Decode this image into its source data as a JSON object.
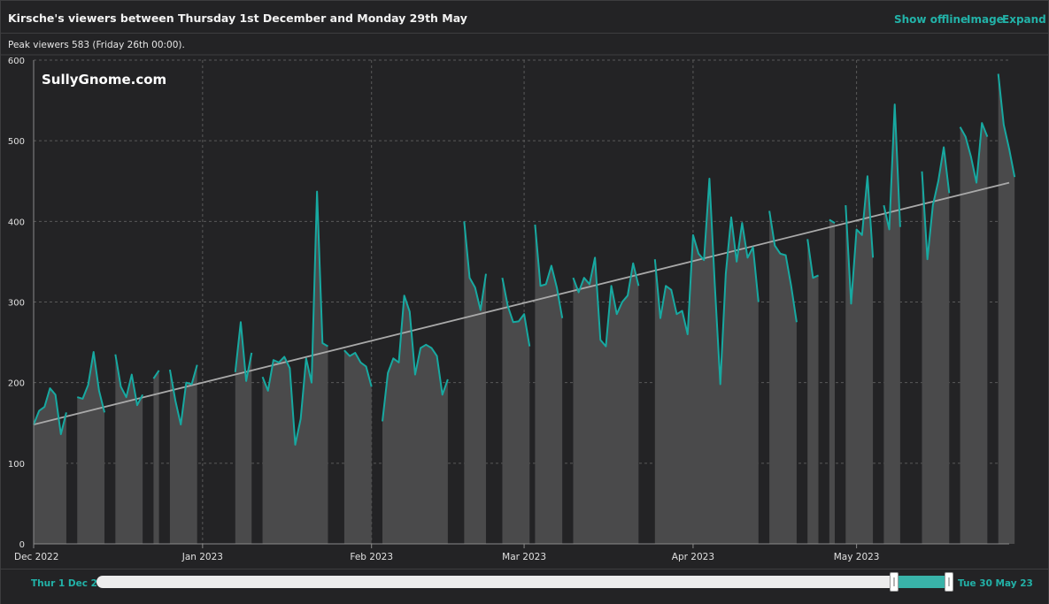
{
  "header": {
    "title": "Kirsche's viewers between Thursday 1st December and Monday 29th May",
    "links": {
      "show_offline": "Show offline",
      "image": "Image",
      "expand": "Expand"
    }
  },
  "peak_text": "Peak viewers 583 (Friday 26th 00:00).",
  "watermark": "SullyGnome.com",
  "range": {
    "start_label": "Thur 1 Dec 22",
    "end_label": "Tue 30 May 23",
    "selected_start_fraction": 0.93,
    "selected_end_fraction": 0.99
  },
  "colors": {
    "line": "#17a9a1",
    "area": "#4a4a4b",
    "trend": "#a9a9a9",
    "grid": "#5a5a5a",
    "accent": "#22b2a8"
  },
  "chart_data": {
    "type": "area",
    "x_unit": "day",
    "x_start": "2022-12-01",
    "x_end": "2023-05-29",
    "ylim": [
      0,
      600
    ],
    "y_ticks": [
      0,
      100,
      200,
      300,
      400,
      500,
      600
    ],
    "x_ticks": [
      {
        "date": "2022-12-01",
        "label": "Dec 2022"
      },
      {
        "date": "2023-01-01",
        "label": "Jan 2023"
      },
      {
        "date": "2023-02-01",
        "label": "Feb 2023"
      },
      {
        "date": "2023-03-01",
        "label": "Mar 2023"
      },
      {
        "date": "2023-04-01",
        "label": "Apr 2023"
      },
      {
        "date": "2023-05-01",
        "label": "May 2023"
      }
    ],
    "grid": true,
    "trend": {
      "start": 148,
      "end": 448
    },
    "series": [
      {
        "type": "area",
        "segments": [
          {
            "start": "2022-12-01",
            "values": [
              148,
              165,
              170,
              193,
              185,
              136,
              163
            ]
          },
          {
            "start": "2022-12-09",
            "values": [
              182,
              180,
              197,
              238,
              190,
              163
            ]
          },
          {
            "start": "2022-12-16",
            "values": [
              235,
              195,
              182,
              210,
              172,
              185
            ]
          },
          {
            "start": "2022-12-23",
            "values": [
              205,
              215
            ]
          },
          {
            "start": "2022-12-26",
            "values": [
              216,
              178,
              148,
              200,
              198,
              222
            ]
          },
          {
            "start": "2023-01-07",
            "values": [
              213,
              275,
              202,
              237
            ]
          },
          {
            "start": "2023-01-12",
            "values": [
              207,
              190,
              228,
              225,
              232,
              218,
              123,
              155,
              230,
              200,
              437,
              249,
              245
            ]
          },
          {
            "start": "2023-01-27",
            "values": [
              240,
              233,
              237,
              225,
              220,
              195
            ]
          },
          {
            "start": "2023-02-03",
            "values": [
              152,
              212,
              230,
              225,
              308,
              288,
              210,
              243,
              247,
              243,
              233,
              185,
              204
            ]
          },
          {
            "start": "2023-02-18",
            "values": [
              400,
              330,
              318,
              290,
              335
            ]
          },
          {
            "start": "2023-02-25",
            "values": [
              330,
              295,
              275,
              276,
              285,
              245
            ]
          },
          {
            "start": "2023-03-03",
            "values": [
              396,
              320,
              322,
              345,
              318,
              280
            ]
          },
          {
            "start": "2023-03-10",
            "values": [
              330,
              312,
              330,
              322,
              355,
              253,
              245,
              320,
              285,
              300,
              308,
              348,
              320
            ]
          },
          {
            "start": "2023-03-25",
            "values": [
              353,
              280,
              320,
              315,
              285,
              289,
              260,
              383,
              360,
              352,
              453,
              320,
              198,
              335,
              405,
              350,
              398,
              355,
              368,
              300
            ]
          },
          {
            "start": "2023-04-15",
            "values": [
              413,
              370,
              360,
              358,
              320,
              275
            ]
          },
          {
            "start": "2023-04-22",
            "values": [
              378,
              330,
              333
            ]
          },
          {
            "start": "2023-04-26",
            "values": [
              402,
              398
            ]
          },
          {
            "start": "2023-04-29",
            "values": [
              420,
              298,
              390,
              383,
              456,
              355
            ]
          },
          {
            "start": "2023-05-06",
            "values": [
              420,
              390,
              545,
              393
            ]
          },
          {
            "start": "2023-05-13",
            "values": [
              462,
              353,
              420,
              450,
              492,
              435
            ]
          },
          {
            "start": "2023-05-20",
            "values": [
              517,
              505,
              480,
              448,
              522,
              505
            ]
          },
          {
            "start": "2023-05-27",
            "values": [
              583,
              520,
              490,
              455
            ]
          }
        ]
      }
    ]
  }
}
